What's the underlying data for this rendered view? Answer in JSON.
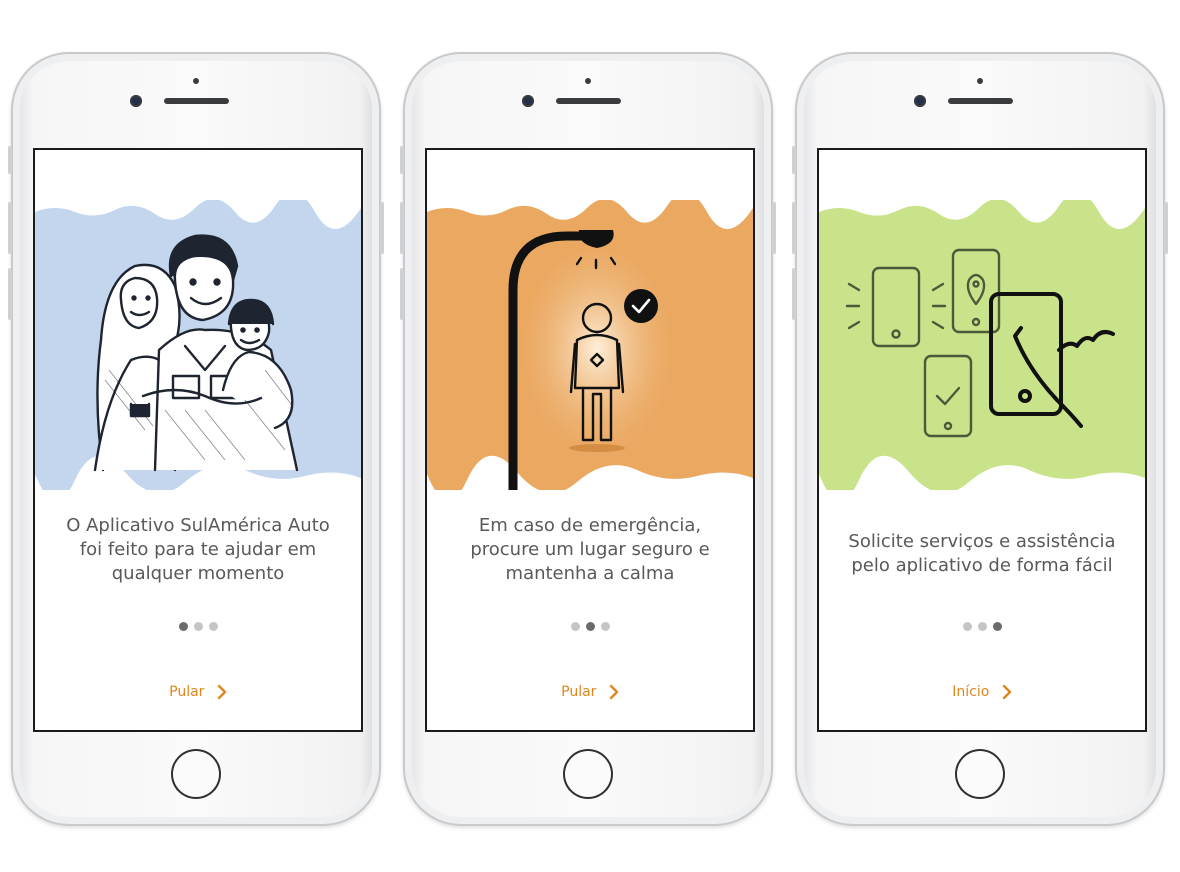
{
  "screens": [
    {
      "caption": "O Aplicativo SulAmérica Auto\nfoi feito para te ajudar em\nqualquer momento",
      "nav_label": "Pular",
      "active_page": 1,
      "bg_color": "#c3d6ee"
    },
    {
      "caption": "Em caso de emergência,\nprocure um lugar seguro e\nmantenha a calma",
      "nav_label": "Pular",
      "active_page": 2,
      "bg_color": "#eaa861"
    },
    {
      "caption": "Solicite serviços e assistência\npelo aplicativo de forma fácil",
      "nav_label": "Início",
      "active_page": 3,
      "bg_color": "#c8e38a"
    }
  ],
  "accent_color": "#e0851c",
  "icons": [
    "family-illustration",
    "street-lamp-person-icon",
    "smartphones-icon",
    "chevron-right-icon"
  ]
}
